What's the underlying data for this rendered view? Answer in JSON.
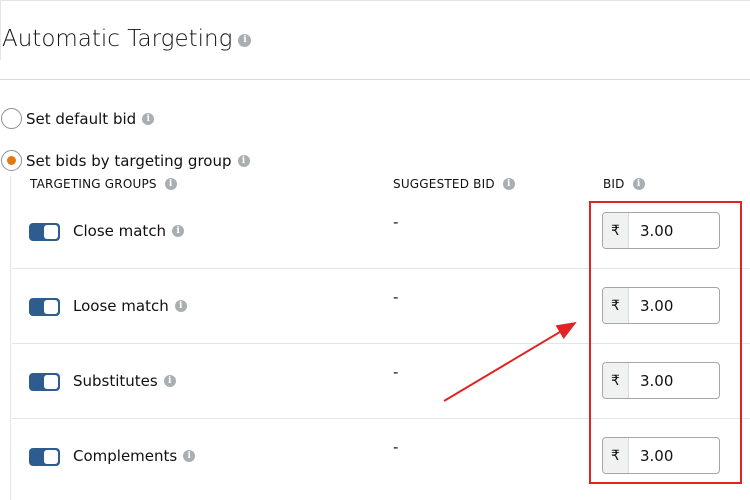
{
  "page": {
    "title": "Automatic Targeting"
  },
  "bid_options": [
    {
      "label": "Set default bid",
      "selected": false
    },
    {
      "label": "Set bids by targeting group",
      "selected": true
    }
  ],
  "table": {
    "headers": {
      "targeting_groups": "TARGETING GROUPS",
      "suggested_bid": "SUGGESTED BID",
      "bid": "BID"
    },
    "rows": [
      {
        "name": "Close match",
        "enabled": true,
        "suggested": "-",
        "currency": "₹",
        "bid": "3.00"
      },
      {
        "name": "Loose match",
        "enabled": true,
        "suggested": "-",
        "currency": "₹",
        "bid": "3.00"
      },
      {
        "name": "Substitutes",
        "enabled": true,
        "suggested": "-",
        "currency": "₹",
        "bid": "3.00"
      },
      {
        "name": "Complements",
        "enabled": true,
        "suggested": "-",
        "currency": "₹",
        "bid": "3.00"
      }
    ]
  },
  "colors": {
    "toggle_on": "#2f5c8f",
    "radio_selected": "#e47911",
    "annotation": "#e02424"
  }
}
